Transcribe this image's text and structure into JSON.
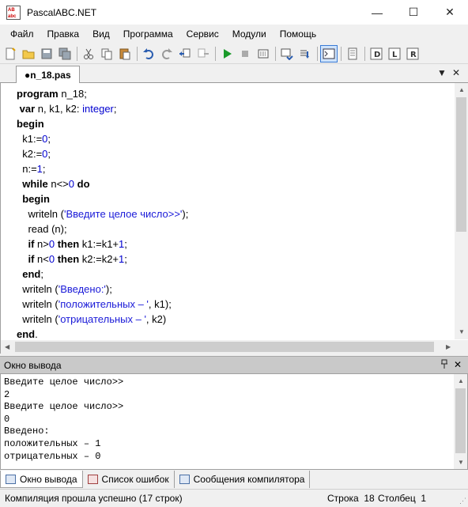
{
  "window": {
    "title": "PascalABC.NET",
    "icon_text": "AB\nabc",
    "minimize": "—",
    "maximize": "☐",
    "close": "✕"
  },
  "menu": [
    "Файл",
    "Правка",
    "Вид",
    "Программа",
    "Сервис",
    "Модули",
    "Помощь"
  ],
  "toolbar": {
    "icons": [
      "new-file-icon",
      "open-folder-icon",
      "save-icon",
      "save-all-icon",
      "cut-icon",
      "copy-icon",
      "paste-icon",
      "undo-icon",
      "redo-icon",
      "navigate-back-icon",
      "navigate-forward-icon",
      "run-icon",
      "stop-icon",
      "compile-icon",
      "debug-step-icon",
      "debug-step-into-icon",
      "output-window-icon",
      "form-designer-icon",
      "code-template-icon",
      "vb-icon",
      "reference-icon"
    ]
  },
  "editor_tab": {
    "label": "●n_18.pas",
    "dropdown": "▼",
    "close": "✕"
  },
  "code": [
    [
      {
        "t": "program",
        "c": "kw"
      },
      {
        "t": " n_18;",
        "c": "plain"
      }
    ],
    [
      {
        "t": " ",
        "c": "plain"
      },
      {
        "t": "var",
        "c": "kw"
      },
      {
        "t": " n, k1, k2: ",
        "c": "plain"
      },
      {
        "t": "integer",
        "c": "type"
      },
      {
        "t": ";",
        "c": "plain"
      }
    ],
    [
      {
        "t": "begin",
        "c": "kw"
      }
    ],
    [
      {
        "t": "  k1:=",
        "c": "plain"
      },
      {
        "t": "0",
        "c": "num"
      },
      {
        "t": ";",
        "c": "plain"
      }
    ],
    [
      {
        "t": "  k2:=",
        "c": "plain"
      },
      {
        "t": "0",
        "c": "num"
      },
      {
        "t": ";",
        "c": "plain"
      }
    ],
    [
      {
        "t": "  n:=",
        "c": "plain"
      },
      {
        "t": "1",
        "c": "num"
      },
      {
        "t": ";",
        "c": "plain"
      }
    ],
    [
      {
        "t": "  ",
        "c": "plain"
      },
      {
        "t": "while",
        "c": "kw"
      },
      {
        "t": " n<>",
        "c": "plain"
      },
      {
        "t": "0",
        "c": "num"
      },
      {
        "t": " ",
        "c": "plain"
      },
      {
        "t": "do",
        "c": "kw"
      }
    ],
    [
      {
        "t": "  ",
        "c": "plain"
      },
      {
        "t": "begin",
        "c": "kw"
      }
    ],
    [
      {
        "t": "    writeln (",
        "c": "plain"
      },
      {
        "t": "'Введите целое число>>'",
        "c": "str"
      },
      {
        "t": ");",
        "c": "plain"
      }
    ],
    [
      {
        "t": "    read (n);",
        "c": "plain"
      }
    ],
    [
      {
        "t": "    ",
        "c": "plain"
      },
      {
        "t": "if",
        "c": "kw"
      },
      {
        "t": " n>",
        "c": "plain"
      },
      {
        "t": "0",
        "c": "num"
      },
      {
        "t": " ",
        "c": "plain"
      },
      {
        "t": "then",
        "c": "kw"
      },
      {
        "t": " k1:=k1+",
        "c": "plain"
      },
      {
        "t": "1",
        "c": "num"
      },
      {
        "t": ";",
        "c": "plain"
      }
    ],
    [
      {
        "t": "    ",
        "c": "plain"
      },
      {
        "t": "if",
        "c": "kw"
      },
      {
        "t": " n<",
        "c": "plain"
      },
      {
        "t": "0",
        "c": "num"
      },
      {
        "t": " ",
        "c": "plain"
      },
      {
        "t": "then",
        "c": "kw"
      },
      {
        "t": " k2:=k2+",
        "c": "plain"
      },
      {
        "t": "1",
        "c": "num"
      },
      {
        "t": ";",
        "c": "plain"
      }
    ],
    [
      {
        "t": "  ",
        "c": "plain"
      },
      {
        "t": "end",
        "c": "kw"
      },
      {
        "t": ";",
        "c": "plain"
      }
    ],
    [
      {
        "t": "  writeln (",
        "c": "plain"
      },
      {
        "t": "'Введено:'",
        "c": "str"
      },
      {
        "t": ");",
        "c": "plain"
      }
    ],
    [
      {
        "t": "  writeln (",
        "c": "plain"
      },
      {
        "t": "'положительных – '",
        "c": "str"
      },
      {
        "t": ", k1);",
        "c": "plain"
      }
    ],
    [
      {
        "t": "  writeln (",
        "c": "plain"
      },
      {
        "t": "'отрицательных – '",
        "c": "str"
      },
      {
        "t": ", k2)",
        "c": "plain"
      }
    ],
    [
      {
        "t": "end",
        "c": "kw"
      },
      {
        "t": ".",
        "c": "plain"
      }
    ]
  ],
  "output_panel": {
    "title": "Окно вывода",
    "pin": "ᚹ",
    "close": "✕",
    "lines": [
      "Введите целое число>>",
      "2",
      "Введите целое число>>",
      "0",
      "Введено:",
      "положительных – 1",
      "отрицательных – 0"
    ]
  },
  "bottom_tabs": [
    {
      "label": "Окно вывода",
      "icon": "output-window-icon",
      "active": true
    },
    {
      "label": "Список ошибок",
      "icon": "error-list-icon",
      "active": false
    },
    {
      "label": "Сообщения компилятора",
      "icon": "compiler-messages-icon",
      "active": false
    }
  ],
  "status": {
    "message": "Компиляция прошла успешно (17 строк)",
    "line_label": "Строка",
    "line_value": "18",
    "col_label": "Столбец",
    "col_value": "1"
  },
  "colors": {
    "keyword": "#000000",
    "number": "#0000d0",
    "string": "#1a1ad8",
    "accent": "#3a7bd5"
  }
}
